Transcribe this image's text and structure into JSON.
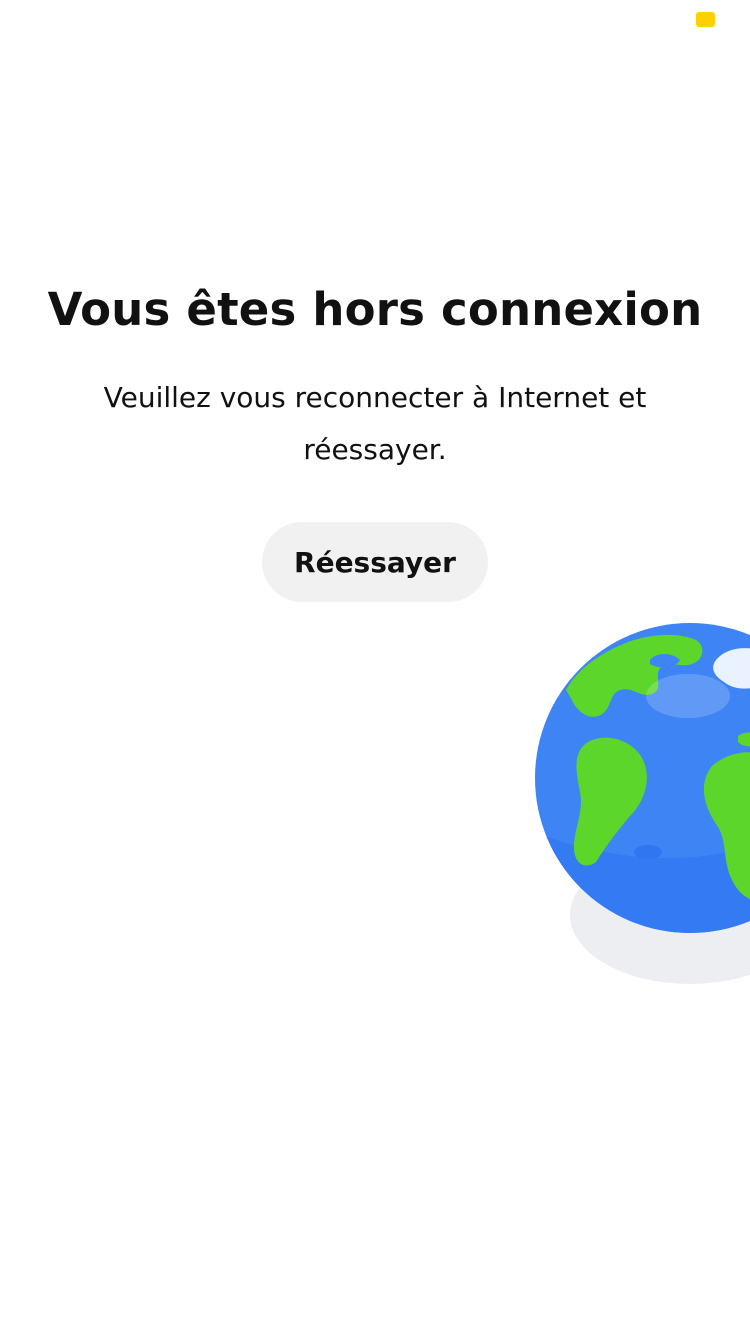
{
  "colors": {
    "background": "#ffffff",
    "text": "#111111",
    "status_indicator": "#FFD000",
    "button_background": "#F1F1F1",
    "globe_ocean": "#3F84F5",
    "globe_land": "#5CD62B",
    "globe_shadow": "#ECEEF1"
  },
  "status_bar": {
    "indicator_icon": "status-indicator-icon"
  },
  "offline": {
    "title": "Vous êtes hors connexion",
    "message": "Veuillez vous reconnecter à Internet et réessayer.",
    "retry_label": "Réessayer"
  },
  "illustration": {
    "icon": "globe-icon"
  }
}
